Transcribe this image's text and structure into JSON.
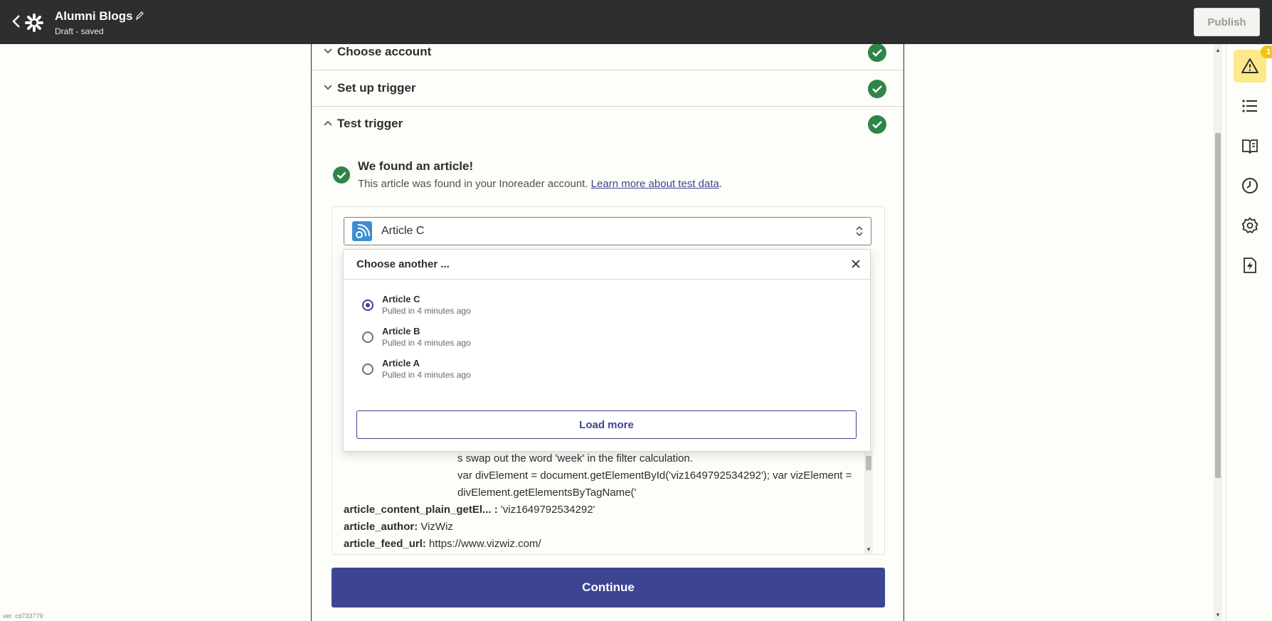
{
  "header": {
    "title": "Alumni Blogs",
    "status": "Draft - saved",
    "publish_label": "Publish"
  },
  "steps": [
    {
      "label": "Choose account",
      "done": true
    },
    {
      "label": "Set up trigger",
      "done": true
    },
    {
      "label": "Test trigger",
      "done": true
    }
  ],
  "test_result": {
    "title": "We found an article!",
    "description": "This article was found in your Inoreader account. ",
    "link_text": "Learn more about test data",
    "link_suffix": "."
  },
  "selector": {
    "selected": "Article C"
  },
  "popup": {
    "title": "Choose another ...",
    "options": [
      {
        "name": "Article C",
        "sub": "Pulled in 4 minutes ago",
        "selected": true
      },
      {
        "name": "Article B",
        "sub": "Pulled in 4 minutes ago",
        "selected": false
      },
      {
        "name": "Article A",
        "sub": "Pulled in 4 minutes ago",
        "selected": false
      }
    ],
    "load_more_label": "Load more"
  },
  "fields": {
    "partial_line_1": "s swap out the word 'week' in the filter calculation.",
    "partial_line_2": "var divElement = document.getElementById('viz1649792534292'); var vizElement = divElement.getElementsByTagName('",
    "rows": [
      {
        "key": "article_content_plain_getEl... :",
        "value": " 'viz1649792534292'"
      },
      {
        "key": "article_author:",
        "value": " VizWiz"
      },
      {
        "key": "article_feed_url:",
        "value": " https://www.vizwiz.com/"
      }
    ]
  },
  "continue_label": "Continue",
  "version": "ver. cd733779",
  "rail": {
    "warning_count": "1"
  },
  "colors": {
    "header_bg": "#2d2e2e",
    "primary": "#3d4592",
    "success": "#2e8549",
    "warning": "#f0c419"
  }
}
